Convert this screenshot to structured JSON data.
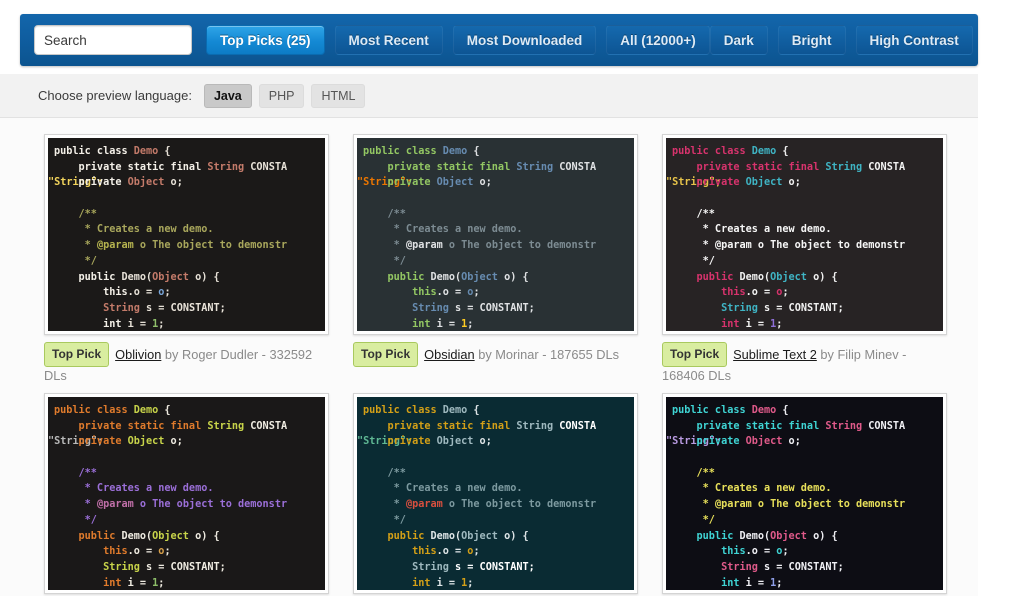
{
  "toolbar": {
    "search": {
      "placeholder": "Search",
      "value": ""
    },
    "tabs": [
      {
        "label": "Top Picks (25)",
        "active": true
      },
      {
        "label": "Most Recent",
        "active": false
      },
      {
        "label": "Most Downloaded",
        "active": false
      },
      {
        "label": "All (12000+)",
        "active": false
      }
    ],
    "filters": [
      {
        "label": "Dark"
      },
      {
        "label": "Bright"
      },
      {
        "label": "High Contrast"
      }
    ],
    "accent_active": "#1489d4",
    "accent_bar": "#0f5d9f"
  },
  "language_bar": {
    "label": "Choose preview language:",
    "options": [
      {
        "label": "Java",
        "active": true
      },
      {
        "label": "PHP",
        "active": false
      },
      {
        "label": "HTML",
        "active": false
      }
    ]
  },
  "code_sample": {
    "lines": [
      "public class Demo {",
      "    private static final String CONSTANT =",
      "    private Object o;",
      "",
      "    /**",
      "     * Creates a new demo.",
      "     * @param o The object to demonstr",
      "     */",
      "    public Demo(Object o) {",
      "        this.o = o;",
      "        String s = CONSTANT;",
      "        int i = 1;"
    ],
    "wrap_fragment": "\"String\";",
    "line2_tail": "String CONSTA"
  },
  "cards": [
    {
      "badge": "Top Pick",
      "name": "Oblivion",
      "by": "by Roger Dudler - 332592 DLs",
      "theme": {
        "bg": "#1b1918",
        "text": "#e8e2d8",
        "keyword": "#f4f0e8",
        "type": "#c47b6a",
        "string": "#f2d45c",
        "comment": "#a9a75c",
        "annotation": "#b5b34f",
        "number": "#8fbf6a",
        "variable": "#7aa6d8",
        "const": "#e8e2d8"
      }
    },
    {
      "badge": "Top Pick",
      "name": "Obsidian",
      "by": "by Morinar - 187655 DLs",
      "theme": {
        "bg": "#293134",
        "text": "#e0e2e4",
        "keyword": "#93c763",
        "type": "#678cb1",
        "string": "#ec7600",
        "comment": "#7d8c93",
        "annotation": "#e0e2e4",
        "number": "#ffcd22",
        "variable": "#678cb1",
        "const": "#e0e2e4"
      }
    },
    {
      "badge": "Top Pick",
      "name": "Sublime Text 2",
      "by": "by Filip Minev - 168406 DLs",
      "theme": {
        "bg": "#272324",
        "text": "#f2f2f2",
        "keyword": "#d8336d",
        "type": "#3fb4c4",
        "string": "#e8c44a",
        "comment": "#f7f7f7",
        "annotation": "#f7f7f7",
        "number": "#8f6fd8",
        "variable": "#d8336d",
        "const": "#f2f2f2"
      }
    },
    {
      "badge": "",
      "name": "",
      "by": "",
      "theme": {
        "bg": "#1a1818",
        "text": "#f0ece2",
        "keyword": "#e07b2c",
        "type": "#c8d44a",
        "string": "#b9b9b9",
        "comment": "#9b6fd8",
        "annotation": "#c06fa8",
        "number": "#8fbf6a",
        "variable": "#d8a04a",
        "const": "#f0ece2"
      }
    },
    {
      "badge": "",
      "name": "",
      "by": "",
      "theme": {
        "bg": "#0a2b33",
        "text": "#dfe6e8",
        "keyword": "#d4a017",
        "type": "#9fb9bf",
        "string": "#5fb894",
        "comment": "#7d9aa0",
        "annotation": "#d84f3f",
        "number": "#d4a017",
        "variable": "#d4a017",
        "const": "#ffffff"
      }
    },
    {
      "badge": "",
      "name": "",
      "by": "",
      "theme": {
        "bg": "#0d0d14",
        "text": "#f0f0f5",
        "keyword": "#3fd4d4",
        "type": "#e05a8a",
        "string": "#b89ae0",
        "comment": "#e8e05a",
        "annotation": "#e8e05a",
        "number": "#8f9fe8",
        "variable": "#3fd4d4",
        "const": "#f0f0f5"
      }
    }
  ]
}
